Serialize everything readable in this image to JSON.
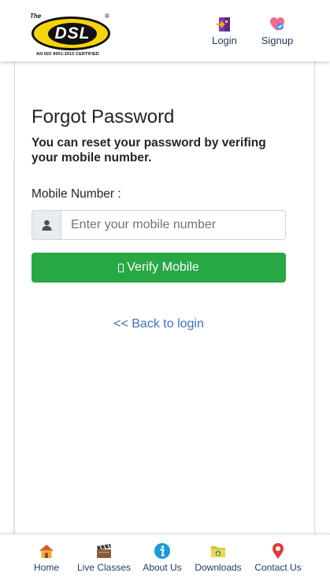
{
  "header": {
    "logo": {
      "prefix": "The",
      "brand": "DSL",
      "registered": "®",
      "certification": "AN ISO 9001:2015 CERTIFIED"
    },
    "login_label": "Login",
    "signup_label": "Signup"
  },
  "form": {
    "title": "Forgot Password",
    "subtitle": "You can reset your password by verifing your mobile number.",
    "mobile_label": "Mobile Number :",
    "mobile_placeholder": "Enter your mobile number",
    "mobile_value": "",
    "verify_button": "Verify Mobile",
    "back_link": "<< Back to login"
  },
  "bottom_nav": {
    "items": [
      {
        "label": "Home",
        "icon": "home-icon"
      },
      {
        "label": "Live Classes",
        "icon": "clapperboard-icon"
      },
      {
        "label": "About Us",
        "icon": "info-icon"
      },
      {
        "label": "Downloads",
        "icon": "folder-download-icon"
      },
      {
        "label": "Contact Us",
        "icon": "location-pin-icon"
      }
    ]
  },
  "colors": {
    "verify_button": "#28a745",
    "link": "#3b73c3",
    "nav_text": "#1f3b5e",
    "logo_yellow": "#f6d40c"
  }
}
